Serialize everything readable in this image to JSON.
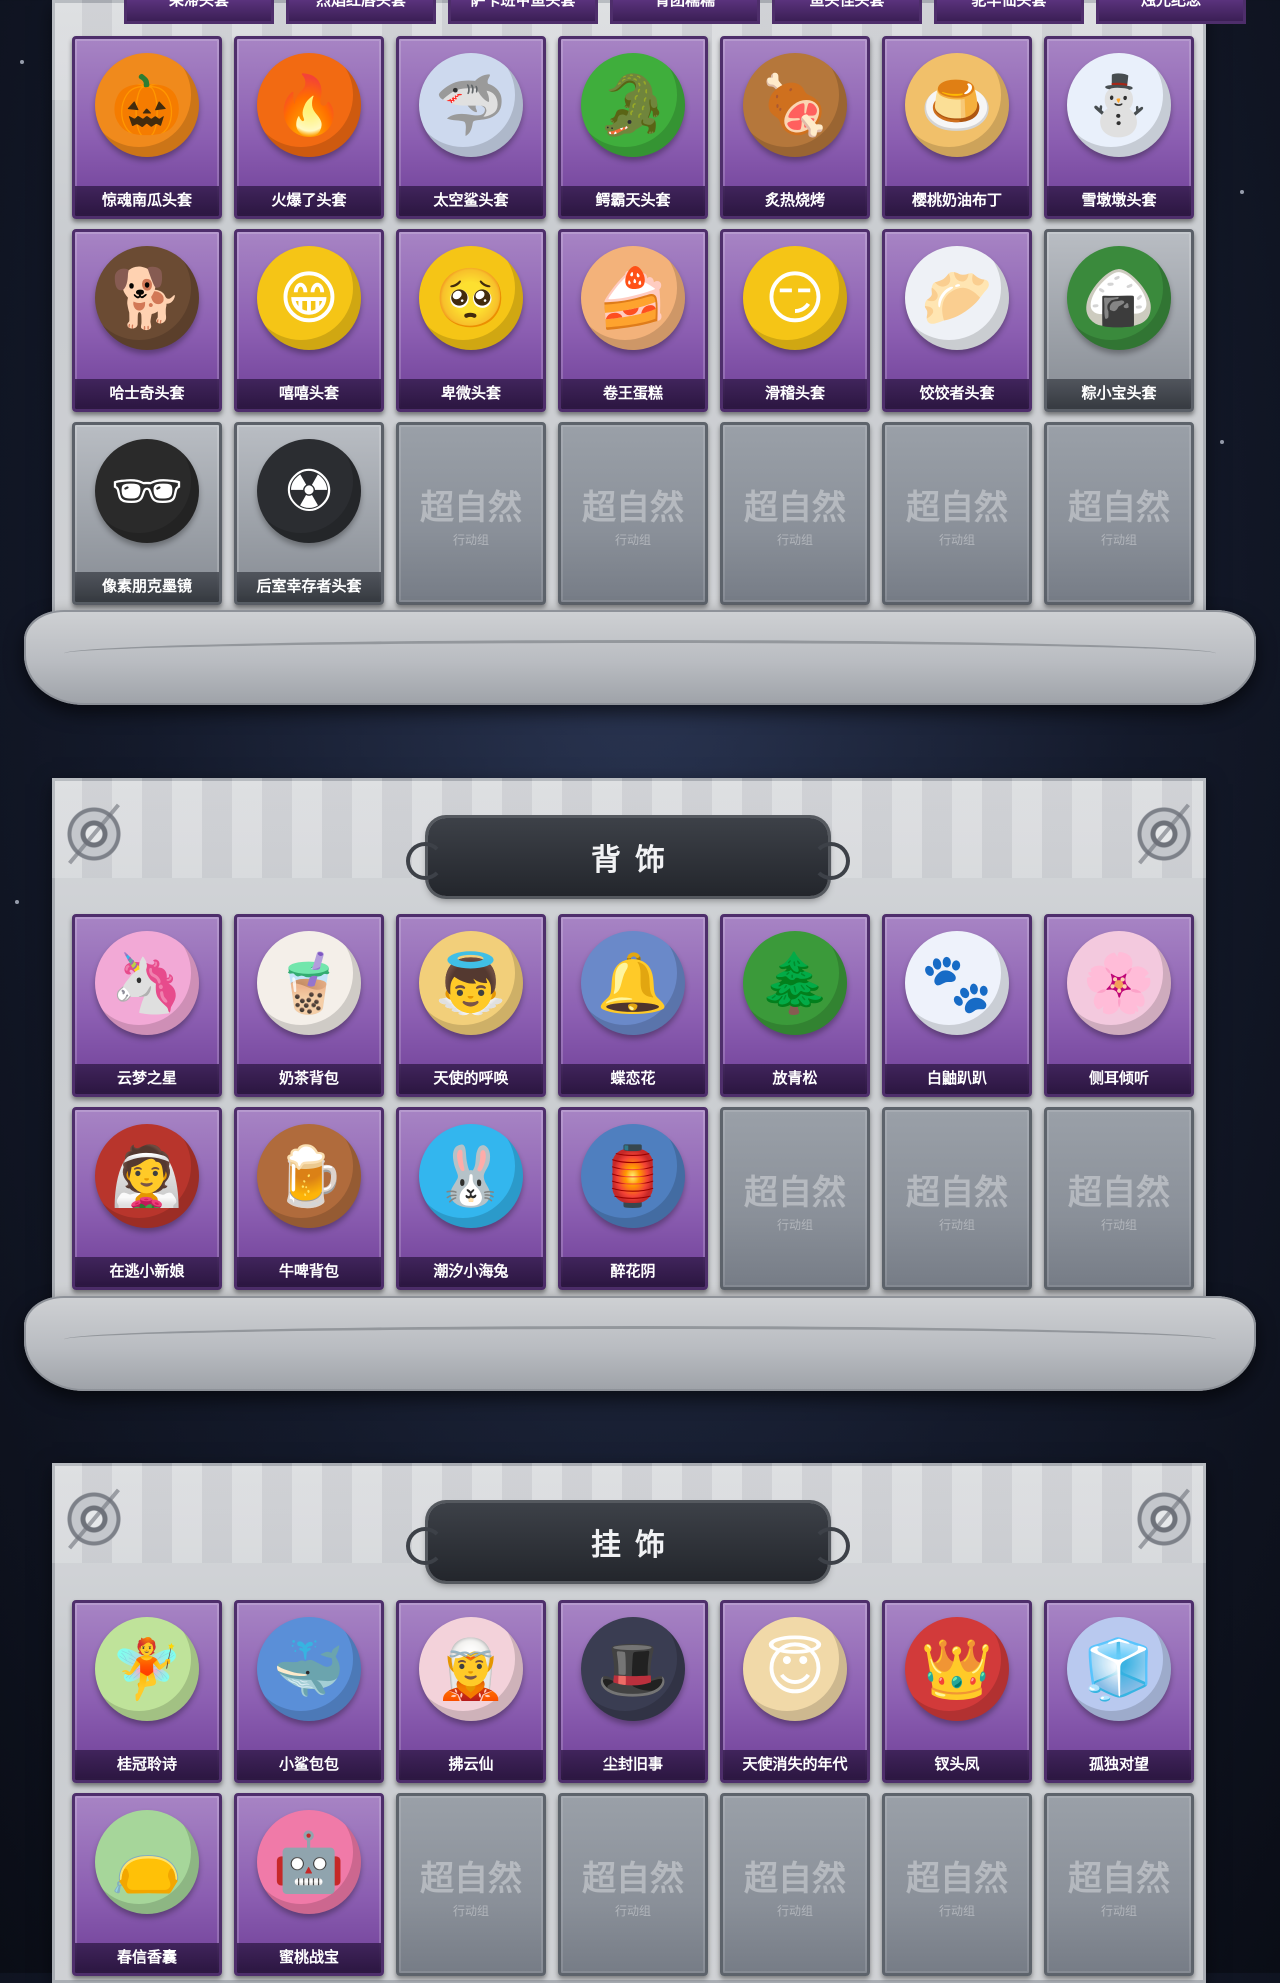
{
  "headwear_top_partial": [
    "呆滞头套",
    "烈焰红唇头套",
    "萨卡班甲鱼头套",
    "青团糯糯",
    "鱼头怪头套",
    "驼羊仙头套",
    "烛光纪念"
  ],
  "headwear": {
    "items": [
      {
        "label": "惊魂南瓜头套",
        "icon": "pumpkin-icon",
        "glyph": "🎃",
        "color": "#f08a1c"
      },
      {
        "label": "火爆了头套",
        "icon": "flame-icon",
        "glyph": "🔥",
        "color": "#f26a12"
      },
      {
        "label": "太空鲨头套",
        "icon": "shark-icon",
        "glyph": "🦈",
        "color": "#cdd9ee"
      },
      {
        "label": "鳄霸天头套",
        "icon": "crocodile-icon",
        "glyph": "🐊",
        "color": "#3fae3c"
      },
      {
        "label": "炙热烧烤",
        "icon": "bbq-icon",
        "glyph": "🍖",
        "color": "#b5773b"
      },
      {
        "label": "樱桃奶油布丁",
        "icon": "pudding-icon",
        "glyph": "🍮",
        "color": "#f1c06a"
      },
      {
        "label": "雪墩墩头套",
        "icon": "snowman-icon",
        "glyph": "⛄",
        "color": "#e9f0fb"
      },
      {
        "label": "哈士奇头套",
        "icon": "dog-icon",
        "glyph": "🐕",
        "color": "#6b4b33"
      },
      {
        "label": "嘻嘻头套",
        "icon": "grin-face-icon",
        "glyph": "😁",
        "color": "#f5c516"
      },
      {
        "label": "卑微头套",
        "icon": "humble-face-icon",
        "glyph": "🥺",
        "color": "#f5c516"
      },
      {
        "label": "卷王蛋糕",
        "icon": "cake-roll-icon",
        "glyph": "🍰",
        "color": "#f3b27a"
      },
      {
        "label": "滑稽头套",
        "icon": "silly-face-icon",
        "glyph": "😏",
        "color": "#f5c516"
      },
      {
        "label": "饺饺者头套",
        "icon": "dumpling-icon",
        "glyph": "🥟",
        "color": "#eef1f6"
      },
      {
        "label": "粽小宝头套",
        "icon": "zongzi-icon",
        "glyph": "🍙",
        "color": "#3a8a3c",
        "gray": true
      },
      {
        "label": "像素朋克墨镜",
        "icon": "pixel-glasses-icon",
        "glyph": "🕶",
        "color": "#2a2a2a",
        "gray": true
      },
      {
        "label": "后室幸存者头套",
        "icon": "gas-mask-icon",
        "glyph": "☢",
        "color": "#2b2d31",
        "gray": true
      }
    ],
    "placeholder_count": 5
  },
  "back_accessories": {
    "title": "背饰",
    "items": [
      {
        "label": "云梦之星",
        "icon": "unicorn-icon",
        "glyph": "🦄",
        "color": "#f2a9d6"
      },
      {
        "label": "奶茶背包",
        "icon": "milk-tea-icon",
        "glyph": "🧋",
        "color": "#f4efe9"
      },
      {
        "label": "天使的呼唤",
        "icon": "angel-icon",
        "glyph": "👼",
        "color": "#f2cf7a"
      },
      {
        "label": "蝶恋花",
        "icon": "bell-icon",
        "glyph": "🔔",
        "color": "#6a89c9"
      },
      {
        "label": "放青松",
        "icon": "pine-tree-icon",
        "glyph": "🌲",
        "color": "#3b9a3a"
      },
      {
        "label": "白鼬趴趴",
        "icon": "ferret-icon",
        "glyph": "🐾",
        "color": "#eef2fb"
      },
      {
        "label": "侧耳倾听",
        "icon": "lotus-icon",
        "glyph": "🌸",
        "color": "#f3c9de"
      },
      {
        "label": "在逃小新娘",
        "icon": "bride-icon",
        "glyph": "👰",
        "color": "#b8352c"
      },
      {
        "label": "牛啤背包",
        "icon": "beer-barrel-icon",
        "glyph": "🍺",
        "color": "#b06b3c"
      },
      {
        "label": "潮汐小海兔",
        "icon": "sea-bunny-icon",
        "glyph": "🐰",
        "color": "#33b6ee"
      },
      {
        "label": "醉花阴",
        "icon": "lantern-icon",
        "glyph": "🏮",
        "color": "#4f7fbf"
      }
    ],
    "placeholder_count": 3
  },
  "pendants": {
    "title": "挂饰",
    "items": [
      {
        "label": "桂冠聆诗",
        "icon": "laurel-doll-icon",
        "glyph": "🧚",
        "color": "#bfe39a"
      },
      {
        "label": "小鲨包包",
        "icon": "shark-bag-icon",
        "glyph": "🐳",
        "color": "#5a8fd8"
      },
      {
        "label": "拂云仙",
        "icon": "fairy-doll-icon",
        "glyph": "🧝",
        "color": "#f3d2da"
      },
      {
        "label": "尘封旧事",
        "icon": "old-story-doll-icon",
        "glyph": "🎩",
        "color": "#3a3d52"
      },
      {
        "label": "天使消失的年代",
        "icon": "angel-doll-icon",
        "glyph": "😇",
        "color": "#f1d9a8"
      },
      {
        "label": "钗头凤",
        "icon": "phoenix-doll-icon",
        "glyph": "👑",
        "color": "#d23a3a"
      },
      {
        "label": "孤独对望",
        "icon": "lonely-doll-icon",
        "glyph": "🧊",
        "color": "#b9c9ef"
      },
      {
        "label": "春信香囊",
        "icon": "sachet-icon",
        "glyph": "👝",
        "color": "#a6d69a"
      },
      {
        "label": "蜜桃战宝",
        "icon": "peach-robot-icon",
        "glyph": "🤖",
        "color": "#f07aa8"
      }
    ],
    "placeholder_count": 5
  },
  "placeholder": {
    "title": "超自然",
    "subtitle": "行动组"
  }
}
